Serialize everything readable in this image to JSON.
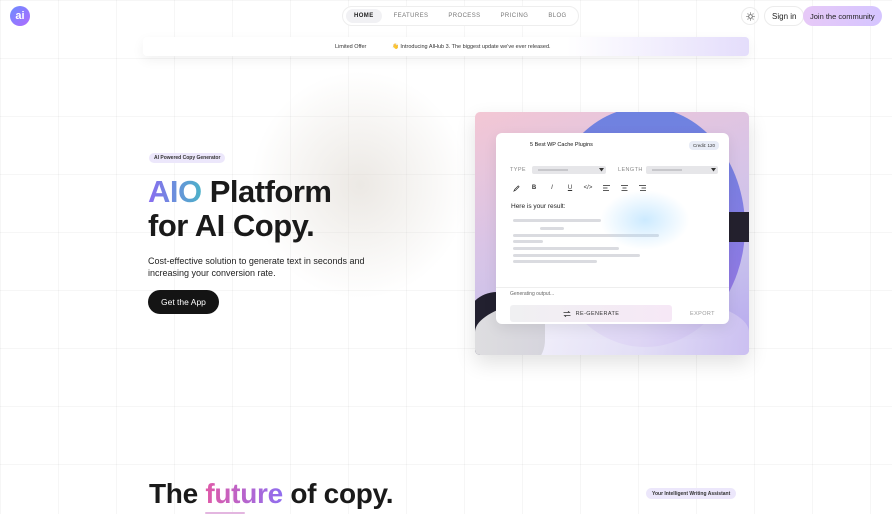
{
  "header": {
    "logo_text": "ai",
    "nav": [
      {
        "label": "HOME",
        "active": true
      },
      {
        "label": "FEATURES",
        "active": false
      },
      {
        "label": "PROCESS",
        "active": false
      },
      {
        "label": "PRICING",
        "active": false
      },
      {
        "label": "BLOG",
        "active": false
      }
    ],
    "theme_icon": "sun-icon",
    "signin_label": "Sign in",
    "join_label": "Join the community"
  },
  "announcement": {
    "tag": "Limited Offer",
    "message": "👋 Introducing AIHub 3. The biggest update we've ever released."
  },
  "hero": {
    "badge": "AI Powered Copy Generator",
    "title_gradient": "AIO",
    "title_line1_rest": " Platform",
    "title_line2": "for AI Copy.",
    "subtitle": "Cost-effective solution to generate text in seconds and increasing your conversion rate.",
    "cta_label": "Get the App"
  },
  "demo": {
    "title": "5 Best WP Cache Plugins",
    "credit": "Credit: 120",
    "type_label": "TYPE",
    "length_label": "LENGTH",
    "toolbar_icons": [
      "pen-icon",
      "bold-icon",
      "italic-icon",
      "underline-icon",
      "code-icon",
      "align-left-icon",
      "align-center-icon",
      "align-right-icon"
    ],
    "result_label": "Here is your result:",
    "generating_label": "Generating output...",
    "regenerate_label": "RE-GENERATE",
    "export_label": "EXPORT"
  },
  "future": {
    "pre": "The ",
    "gradient": "future",
    "post": " of copy.",
    "badge": "Your Intelligent Writing Assistant"
  },
  "colors": {
    "accent_purple": "#8a6cf0",
    "accent_teal": "#4bb2c8",
    "cta_dark": "#141414"
  }
}
